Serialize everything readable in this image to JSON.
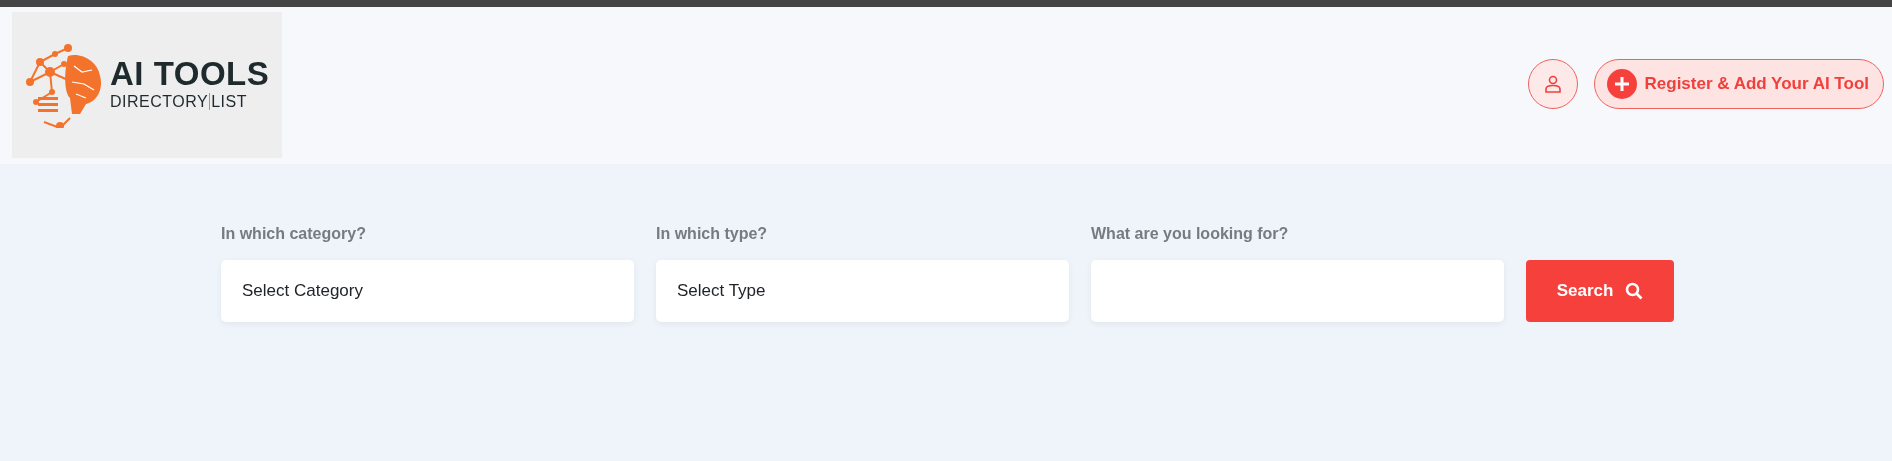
{
  "header": {
    "logo": {
      "title": "AI TOOLS",
      "subtitle_left": "DIRECTORY",
      "subtitle_right": "LIST"
    },
    "register_button": {
      "label": "Register & Add Your AI Tool"
    }
  },
  "search_form": {
    "fields": [
      {
        "label": "In which category?",
        "value": "Select Category"
      },
      {
        "label": "In which type?",
        "value": "Select Type"
      },
      {
        "label": "What are you looking for?"
      }
    ],
    "search_button": {
      "label": "Search"
    }
  }
}
